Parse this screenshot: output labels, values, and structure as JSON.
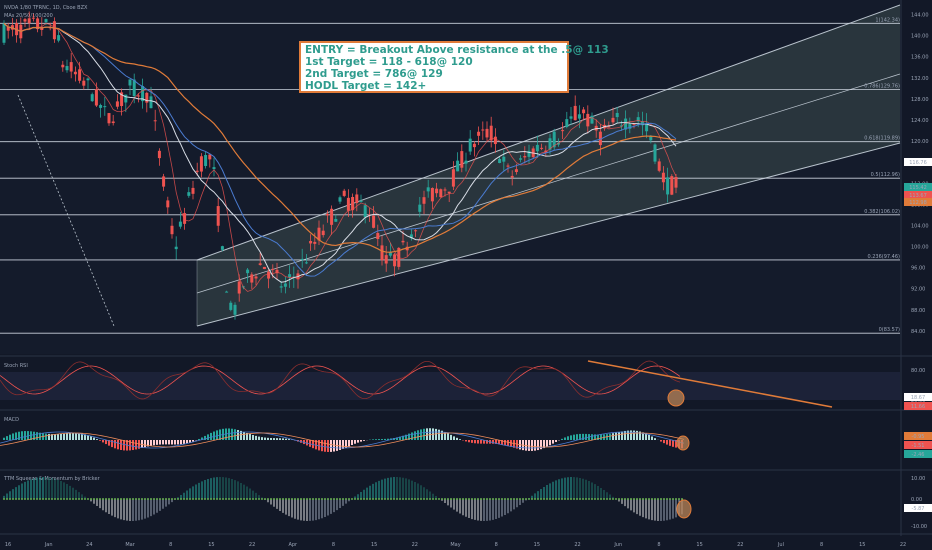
{
  "chart_data": [
    {
      "type": "candlestick",
      "header": {
        "symbol": "NVDA 1/80 TFRNC, 1D, Cboe BZX",
        "indicator": "MAs 20/50/100/200"
      },
      "price_axis": {
        "min": 80,
        "max": 146,
        "ticks": [
          144,
          140,
          136,
          132,
          128,
          124,
          120,
          116,
          112,
          108,
          104,
          100,
          96,
          92,
          88,
          84
        ]
      },
      "fibonacci_levels": [
        {
          "label": "1(142.34)",
          "value": 142.34
        },
        {
          "label": "0.786(129.76)",
          "value": 129.76
        },
        {
          "label": "0.618(119.89)",
          "value": 119.89
        },
        {
          "label": "0.5(112.96)",
          "value": 112.96
        },
        {
          "label": "0.382(106.02)",
          "value": 106.02
        },
        {
          "label": "0.236(97.46)",
          "value": 97.46
        },
        {
          "label": "0(83.57)",
          "value": 83.57
        }
      ],
      "price_badges": [
        {
          "text": "116.76",
          "color": "#ffffff",
          "text_color": "#121827"
        },
        {
          "text": "115.42",
          "color": "#26a69a",
          "text_color": "#ffffff"
        },
        {
          "text": "113.67",
          "color": "#ef5350",
          "text_color": "#ffffff"
        },
        {
          "text": "112.98",
          "color": "#e07b39",
          "text_color": "#ffffff"
        }
      ],
      "x_axis_ticks": [
        "16",
        "Jan",
        "24",
        "Mar",
        "8",
        "15",
        "22",
        "Apr",
        "8",
        "15",
        "22",
        "May",
        "8",
        "15",
        "22",
        "Jun",
        "8",
        "15",
        "22",
        "Jul",
        "8",
        "15",
        "22"
      ],
      "colors": {
        "up": "#26a69a",
        "down": "#ef5350",
        "channel": "#b8c2cc",
        "ma_slow": "#e07b39",
        "ma_fast": "#d8dde6",
        "ma_mid": "#4a7bd0"
      }
    },
    {
      "type": "line",
      "title": "Stoch RSI",
      "axis_ticks": [
        "80.00",
        "20.00"
      ],
      "badges": [
        "18.67",
        "11.66"
      ]
    },
    {
      "type": "histogram",
      "title": "MACD",
      "badges": [
        "-0.95",
        "-1.51",
        "-2.46"
      ]
    },
    {
      "type": "histogram",
      "title": "TTM Squeeze & Momentum by Bricker",
      "axis_ticks": [
        "10.00",
        "0.00",
        "-10.00"
      ],
      "badges": [
        "-5.87"
      ]
    }
  ],
  "annotation": {
    "lines": [
      "ENTRY = Breakout Above resistance at the .5@ 113",
      "1st Target = 118 - 618@ 120",
      "2nd Target = 786@ 129",
      "HODL Target = 142+"
    ],
    "text_color": "#2f9c8e",
    "border_color": "#e07b39"
  }
}
